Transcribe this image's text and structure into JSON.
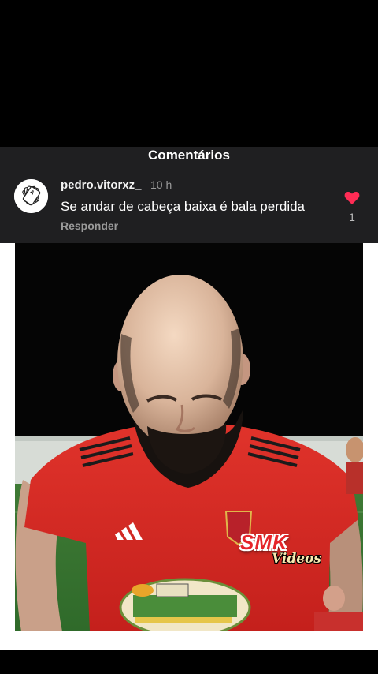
{
  "comments": {
    "title": "Comentários",
    "item": {
      "username": "pedro.vitorxz_",
      "time": "10 h",
      "text": "Se andar de cabeça baixa é bala perdida",
      "reply_label": "Responder",
      "likes": "1",
      "avatar_icon": "playing-cards-avatar",
      "like_color": "#fe2c55"
    }
  },
  "video": {
    "watermark_main": "SMK",
    "watermark_sub": "Videos",
    "shirt_color": "#d0231f"
  }
}
